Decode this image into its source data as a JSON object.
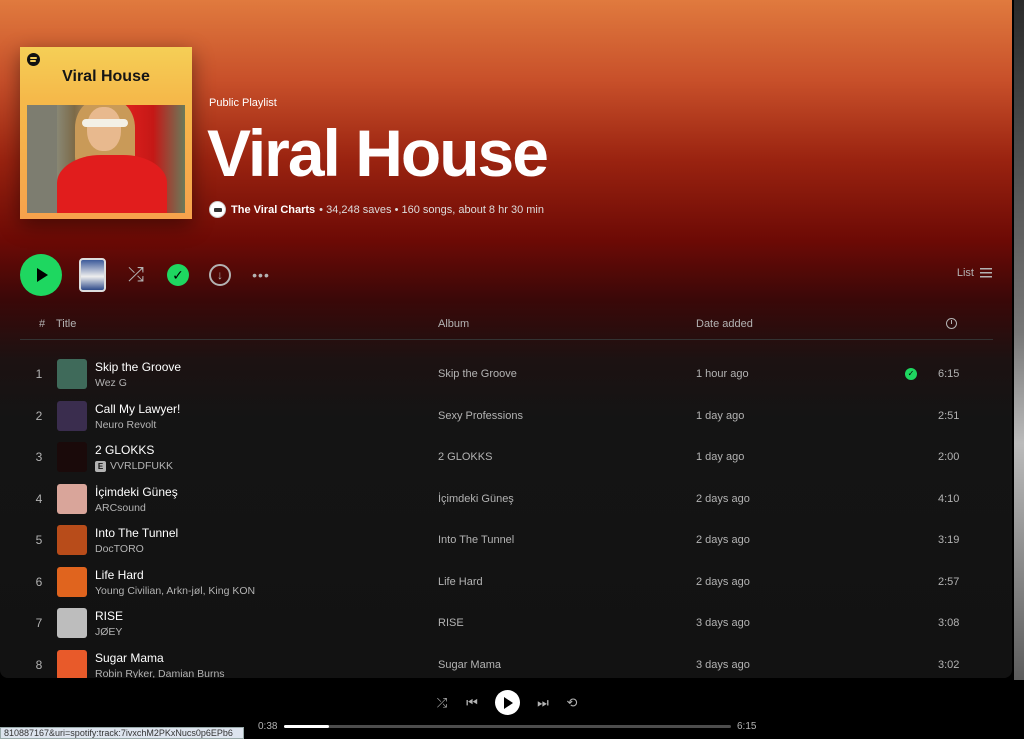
{
  "header": {
    "cover_title": "Viral House",
    "type_label": "Public Playlist",
    "title": "Viral House",
    "owner": "The Viral Charts",
    "stats": "• 34,248 saves • 160 songs, about 8 hr 30 min"
  },
  "controls": {
    "view_label": "List",
    "more_label": "•••"
  },
  "table": {
    "headers": {
      "num": "#",
      "title": "Title",
      "album": "Album",
      "date": "Date added"
    },
    "rows": [
      {
        "num": "1",
        "name": "Skip the Groove",
        "artist": "Wez G",
        "explicit": false,
        "album": "Skip the Groove",
        "date": "1 hour ago",
        "saved": true,
        "duration": "6:15",
        "thumb_color": "#3f6a5a"
      },
      {
        "num": "2",
        "name": "Call My Lawyer!",
        "artist": "Neuro Revolt",
        "explicit": false,
        "album": "Sexy Professions",
        "date": "1 day ago",
        "saved": false,
        "duration": "2:51",
        "thumb_color": "#3a2d4e"
      },
      {
        "num": "3",
        "name": "2 GLOKKS",
        "artist": "VVRLDFUKK",
        "explicit": true,
        "album": "2 GLOKKS",
        "date": "1 day ago",
        "saved": false,
        "duration": "2:00",
        "thumb_color": "#1a0a0a"
      },
      {
        "num": "4",
        "name": "İçimdeki Güneş",
        "artist": "ARCsound",
        "explicit": false,
        "album": "İçimdeki Güneş",
        "date": "2 days ago",
        "saved": false,
        "duration": "4:10",
        "thumb_color": "#d9a59a"
      },
      {
        "num": "5",
        "name": "Into The Tunnel",
        "artist": "DocTORO",
        "explicit": false,
        "album": "Into The Tunnel",
        "date": "2 days ago",
        "saved": false,
        "duration": "3:19",
        "thumb_color": "#b84c1a"
      },
      {
        "num": "6",
        "name": "Life Hard",
        "artist": "Young Civilian, Arkn-jøl, King KON",
        "explicit": false,
        "album": "Life Hard",
        "date": "2 days ago",
        "saved": false,
        "duration": "2:57",
        "thumb_color": "#e0641e"
      },
      {
        "num": "7",
        "name": "RISE",
        "artist": "JØEY",
        "explicit": false,
        "album": "RISE",
        "date": "3 days ago",
        "saved": false,
        "duration": "3:08",
        "thumb_color": "#bdbdbd"
      },
      {
        "num": "8",
        "name": "Sugar Mama",
        "artist": "Robin Ryker, Damian Burns",
        "explicit": false,
        "album": "Sugar Mama",
        "date": "3 days ago",
        "saved": false,
        "duration": "3:02",
        "thumb_color": "#e85a2a"
      }
    ]
  },
  "player": {
    "elapsed": "0:38",
    "total": "6:15",
    "progress_fraction": 0.1
  },
  "status_url": "810887167&uri=spotify:track:7ivxchM2PKxNucs0p6EPb6",
  "colors": {
    "accent": "#1ed760"
  }
}
